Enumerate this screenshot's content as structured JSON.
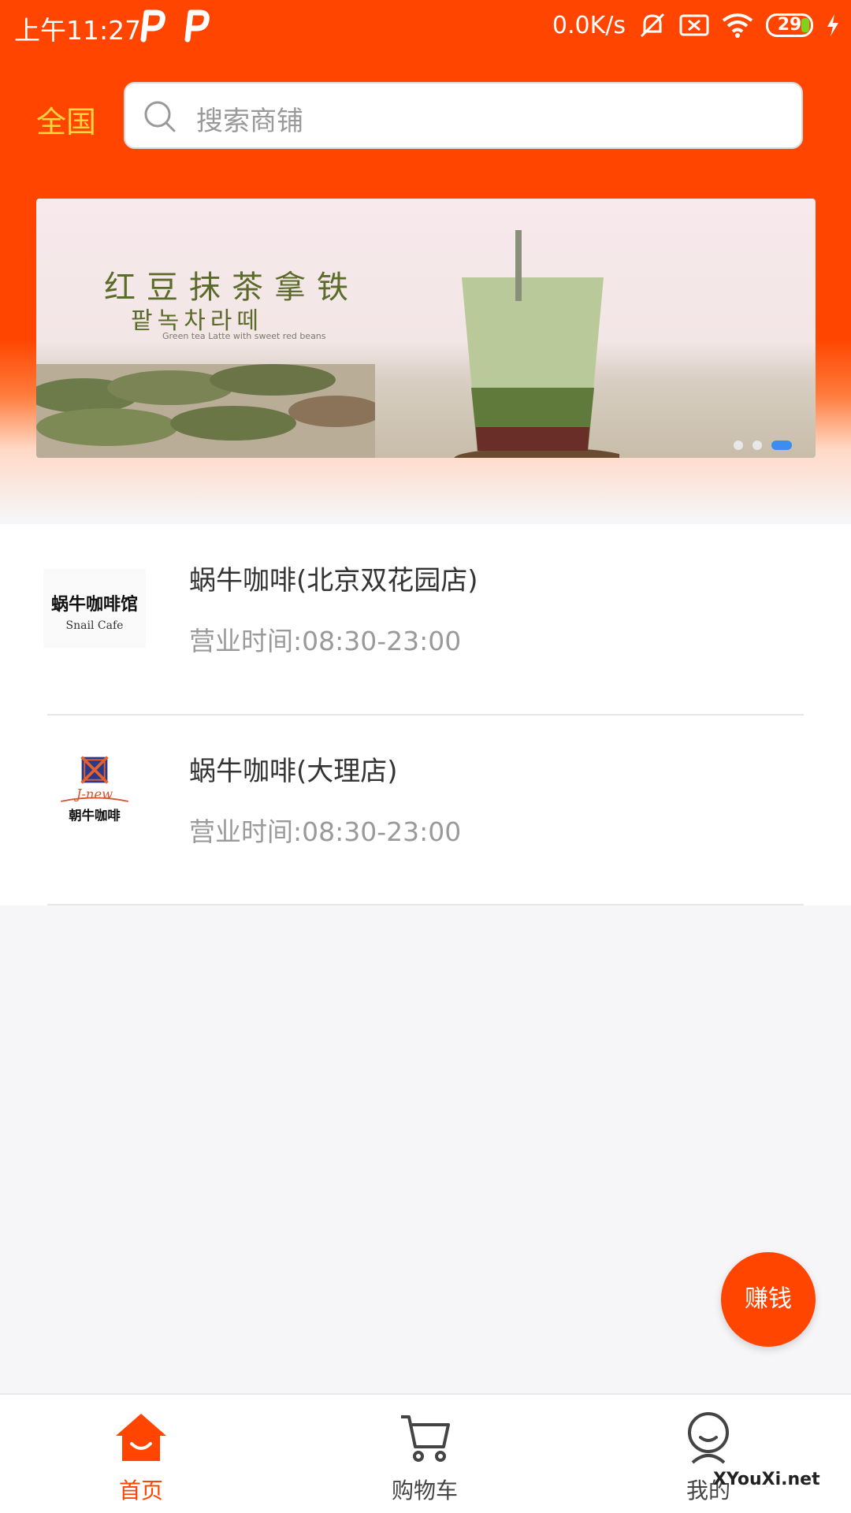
{
  "status_bar": {
    "time": "上午11:27",
    "network_speed": "0.0K/s",
    "battery": "29"
  },
  "header": {
    "region": "全国",
    "search_placeholder": "搜索商铺"
  },
  "banner": {
    "title": "红豆抹茶拿铁",
    "subtitle": "팥녹차라떼",
    "caption": "Green tea Latte with sweet red beans",
    "page_count": 3,
    "active_index": 2
  },
  "shops": [
    {
      "name": "蜗牛咖啡(北京双花园店)",
      "hours": "营业时间:08:30-23:00",
      "logo_text": "蜗牛咖啡馆",
      "logo_sub": "Snail Cafe"
    },
    {
      "name": "蜗牛咖啡(大理店)",
      "hours": "营业时间:08:30-23:00",
      "logo_text": "朝牛咖啡",
      "logo_sub": "J-new"
    }
  ],
  "fab": {
    "label": "赚钱"
  },
  "tab_bar": {
    "items": [
      {
        "label": "首页",
        "icon": "home-icon",
        "active": true
      },
      {
        "label": "购物车",
        "icon": "cart-icon",
        "active": false
      },
      {
        "label": "我的",
        "icon": "profile-icon",
        "active": false
      }
    ]
  },
  "watermark": "XYouXi.net",
  "colors": {
    "brand": "#ff4500",
    "region_text": "#ffd23f",
    "active_dot": "#3b8ef0"
  }
}
